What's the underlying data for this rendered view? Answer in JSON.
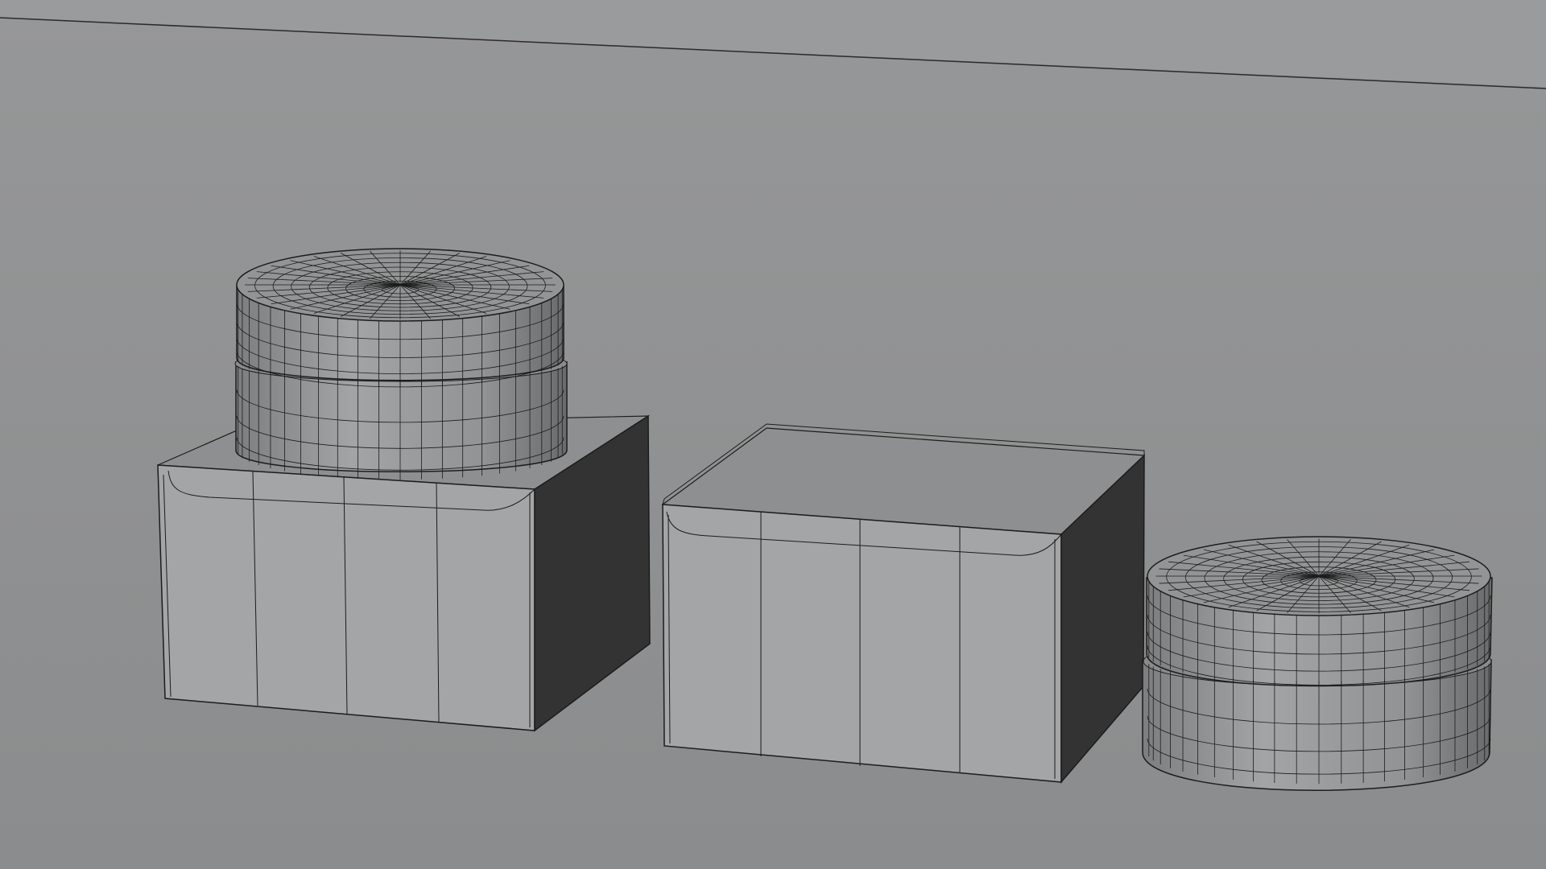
{
  "scene": {
    "background": "#8f9091",
    "wireframe_color": "#1c1c1c",
    "front_face_color": "#a4a5a6",
    "top_face_color": "#8e8f90",
    "side_face_color": "#343334",
    "jar_body_color": "#9a9b9c",
    "objects": [
      "cardboard-box-left",
      "cosmetic-jar-on-box",
      "cardboard-box-center",
      "cosmetic-jar-right"
    ]
  }
}
